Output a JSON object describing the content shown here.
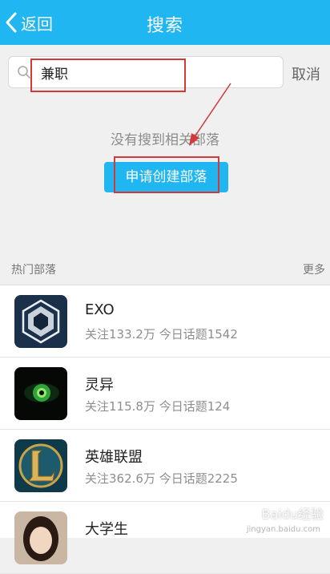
{
  "header": {
    "back_label": "返回",
    "title": "搜索"
  },
  "search": {
    "query": "兼职",
    "cancel_label": "取消"
  },
  "empty_state": {
    "message": "没有搜到相关部落",
    "create_button_label": "申请创建部落"
  },
  "hot_section": {
    "title": "热门部落",
    "more_label": "更多",
    "items": [
      {
        "name": "EXO",
        "stats": "关注133.2万 今日话题1542",
        "avatar_icon": "exo-logo"
      },
      {
        "name": "灵异",
        "stats": "关注115.8万 今日话题124",
        "avatar_icon": "green-eye"
      },
      {
        "name": "英雄联盟",
        "stats": "关注362.6万 今日话题2225",
        "avatar_icon": "league-of-legends-logo"
      },
      {
        "name": "大学生",
        "stats": "",
        "avatar_icon": "girl-photo"
      }
    ]
  },
  "watermark": {
    "text": "Baidu经验",
    "sub": "jingyan.baidu.com"
  },
  "colors": {
    "accent": "#1fb6f2",
    "annotation": "#d23a3a"
  }
}
